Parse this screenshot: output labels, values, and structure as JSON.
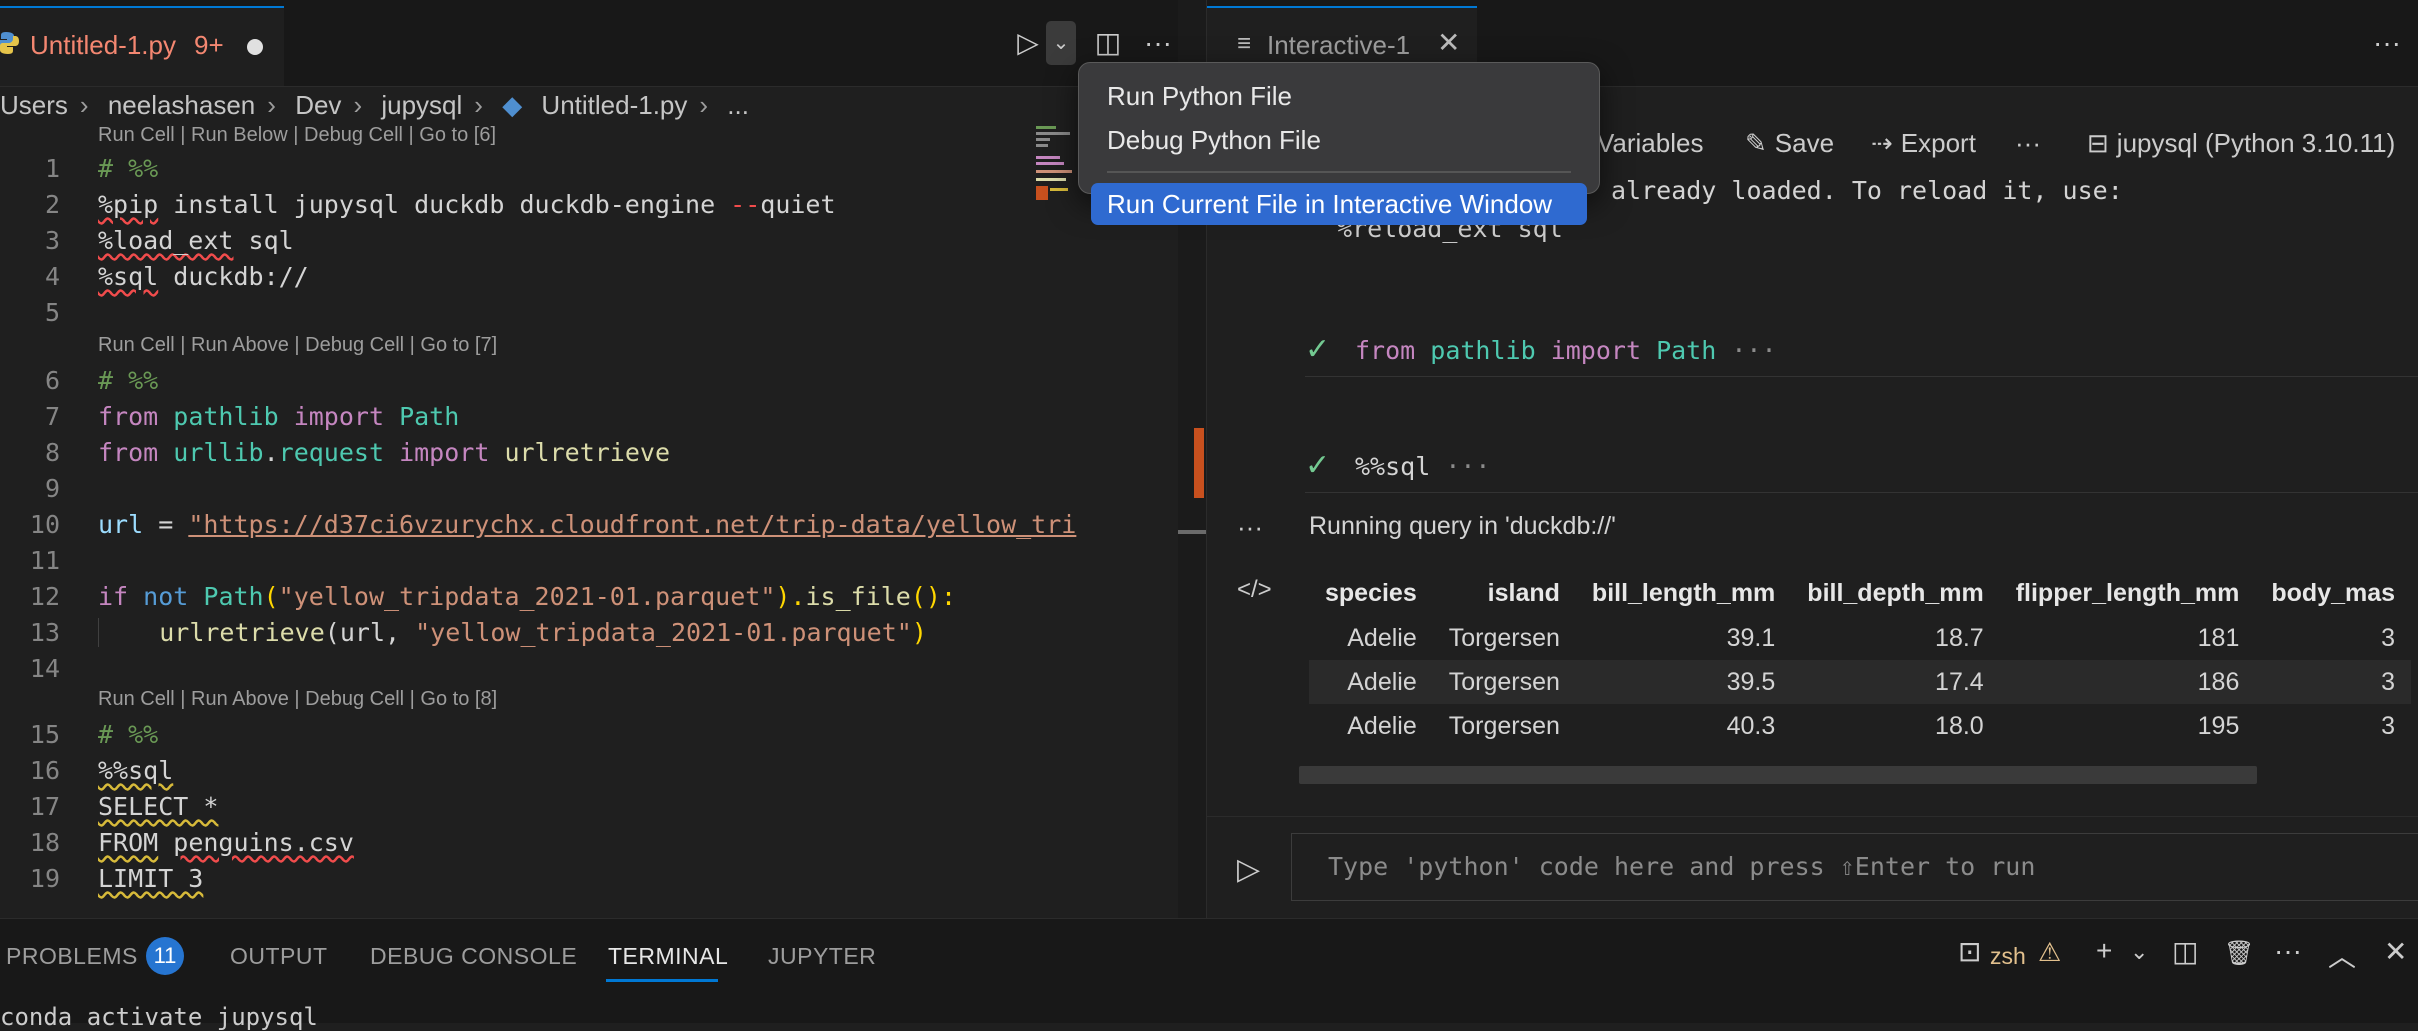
{
  "editor": {
    "tab": {
      "icon": "python-icon",
      "title": "Untitled-1.py",
      "badge": "9+",
      "dirty": "●"
    },
    "toolbar": {
      "run_icon": "▷",
      "dropdown_icon": "⌄",
      "split_icon": "◫",
      "more_icon": "···"
    },
    "breadcrumb": [
      "Users",
      "neelashasen",
      "Dev",
      "jupysql",
      "Untitled-1.py",
      "..."
    ],
    "lenses": [
      "Run Cell | Run Below | Debug Cell | Go to [6]",
      "Run Cell | Run Above | Debug Cell | Go to [7]",
      "Run Cell | Run Above | Debug Cell | Go to [8]"
    ],
    "line_numbers": [
      "1",
      "2",
      "3",
      "4",
      "5",
      "6",
      "7",
      "8",
      "9",
      "10",
      "11",
      "12",
      "13",
      "14",
      "15",
      "16",
      "17",
      "18",
      "19"
    ],
    "code": {
      "l1": "# %%",
      "l2_a": "%pip",
      "l2_b": " install jupysql duckdb duckdb-engine ",
      "l2_c": "--",
      "l2_d": "quiet",
      "l3_a": "%load_ext",
      "l3_b": " sql",
      "l4_a": "%sql",
      "l4_b": " duckdb://",
      "l6": "# %%",
      "l7_a": "from",
      "l7_b": "pathlib",
      "l7_c": "import",
      "l7_d": "Path",
      "l8_a": "from",
      "l8_b": "urllib",
      "l8_c": ".",
      "l8_d": "request",
      "l8_e": "import",
      "l8_f": "urlretrieve",
      "l10_a": "url",
      "l10_b": " = ",
      "l10_c": "\"https://d37ci6vzurychx.cloudfront.net/trip-data/yellow_tri",
      "l12_a": "if",
      "l12_b": "not",
      "l12_c": "Path",
      "l12_d": "(",
      "l12_e": "\"yellow_tripdata_2021-01.parquet\"",
      "l12_f": ").",
      "l12_g": "is_file",
      "l12_h": "():",
      "l13_a": "urlretrieve",
      "l13_b": "(url, ",
      "l13_c": "\"yellow_tripdata_2021-01.parquet\"",
      "l13_d": ")",
      "l15": "# %%",
      "l16": "%%sql",
      "l17": "SELECT *",
      "l18_a": "FROM",
      "l18_b": "penguins.csv",
      "l19": "LIMIT 3"
    }
  },
  "dropdown": {
    "items": [
      "Run Python File",
      "Debug Python File",
      "Run Current File in Interactive Window"
    ]
  },
  "interactive": {
    "tab": {
      "icon": "≡",
      "title": "Interactive-1",
      "close": "✕"
    },
    "more_icon": "···",
    "toolbar": {
      "variables": "Variables",
      "save": "Save",
      "export": "Export",
      "more": "···",
      "kernel": "jupysql (Python 3.10.11)"
    },
    "output_line": "already loaded. To reload it, use:",
    "output_line2": "%reload_ext sql",
    "cells": [
      {
        "check": "✓",
        "code_a": "from",
        "code_b": "pathlib",
        "code_c": "import",
        "code_d": "Path",
        "ellipsis": "···"
      },
      {
        "check": "✓",
        "code": "%%sql",
        "ellipsis": "···"
      }
    ],
    "gutter_more": "···",
    "gutter_code": "</>",
    "running": "Running query in 'duckdb://'",
    "table": {
      "headers": [
        "species",
        "island",
        "bill_length_mm",
        "bill_depth_mm",
        "flipper_length_mm",
        "body_mas"
      ],
      "rows": [
        [
          "Adelie",
          "Torgersen",
          "39.1",
          "18.7",
          "181",
          "3"
        ],
        [
          "Adelie",
          "Torgersen",
          "39.5",
          "17.4",
          "186",
          "3"
        ],
        [
          "Adelie",
          "Torgersen",
          "40.3",
          "18.0",
          "195",
          "3"
        ]
      ]
    },
    "input": {
      "run_icon": "▷",
      "placeholder": "Type 'python' code here and press ⇧Enter to run"
    }
  },
  "panel": {
    "tabs": [
      "PROBLEMS",
      "OUTPUT",
      "DEBUG CONSOLE",
      "TERMINAL",
      "JUPYTER"
    ],
    "problems_count": "11",
    "terminal_text": "conda activate jupysql",
    "shell": "zsh",
    "icons": {
      "terminal": "⊡",
      "warning": "⚠",
      "add": "+",
      "add_dropdown": "⌄",
      "split": "◫",
      "trash": "🗑",
      "more": "···",
      "maximize": "︿",
      "close": "✕"
    }
  }
}
